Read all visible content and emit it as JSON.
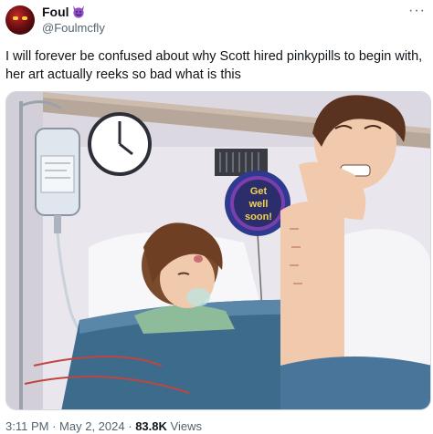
{
  "author": {
    "display_name": "Foul",
    "handle": "@Foulmcfly",
    "name_emoji": "smiling-devil-emoji",
    "avatar_icon": "red-demon-avatar"
  },
  "tweet": {
    "text": "I will forever be confused about why Scott hired pinkypills to begin with, her art actually reeks so bad what is this"
  },
  "media": {
    "balloon_text": [
      "Get",
      "well",
      "soon!"
    ]
  },
  "meta": {
    "time": "3:11 PM",
    "separator": "·",
    "date": "May 2, 2024",
    "views_count": "83.8K",
    "views_label": "Views"
  },
  "icons": {
    "more": "more-options-icon"
  },
  "colors": {
    "text_primary": "#0f1419",
    "text_secondary": "#536471",
    "border": "#cfd9de"
  }
}
